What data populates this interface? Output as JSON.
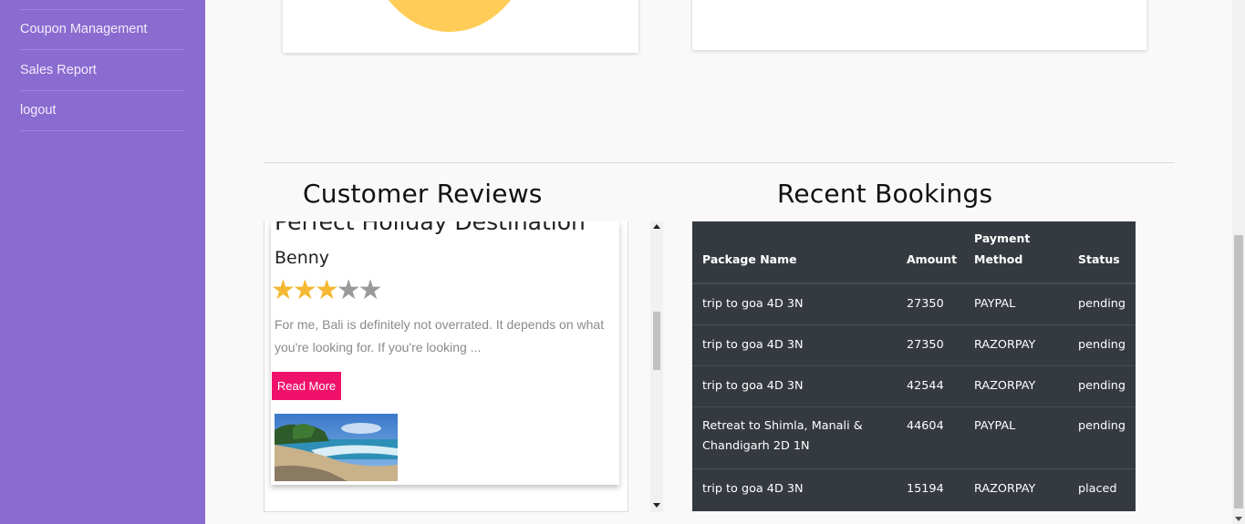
{
  "sidebar": {
    "items": [
      {
        "label": "Coupon Management"
      },
      {
        "label": "Sales Report"
      },
      {
        "label": "logout"
      }
    ]
  },
  "reviews": {
    "title": "Customer Reviews",
    "card": {
      "heading": "Perfect Holiday Destination",
      "reviewer": "Benny",
      "rating": 3,
      "max_rating": 5,
      "text": "For me, Bali is definitely not overrated. It depends on what you're looking for. If you're looking ...",
      "read_more_label": "Read More"
    }
  },
  "bookings": {
    "title": "Recent Bookings",
    "columns": [
      "Package Name",
      "Amount",
      "Payment Method",
      "Status"
    ],
    "rows": [
      {
        "package": "trip to goa 4D 3N",
        "amount": "27350",
        "method": "PAYPAL",
        "status": "pending"
      },
      {
        "package": "trip to goa 4D 3N",
        "amount": "27350",
        "method": "RAZORPAY",
        "status": "pending"
      },
      {
        "package": "trip to goa 4D 3N",
        "amount": "42544",
        "method": "RAZORPAY",
        "status": "pending"
      },
      {
        "package": "Retreat to Shimla, Manali & Chandigarh 2D 1N",
        "amount": "44604",
        "method": "PAYPAL",
        "status": "pending"
      },
      {
        "package": "trip to goa 4D 3N",
        "amount": "15194",
        "method": "RAZORPAY",
        "status": "placed"
      }
    ]
  },
  "colors": {
    "sidebar_bg": "#8a6bd0",
    "accent_pink": "#f0126a",
    "star_on": "#f4b832",
    "table_bg": "#353a40",
    "chart_yellow": "#ffcd57"
  }
}
